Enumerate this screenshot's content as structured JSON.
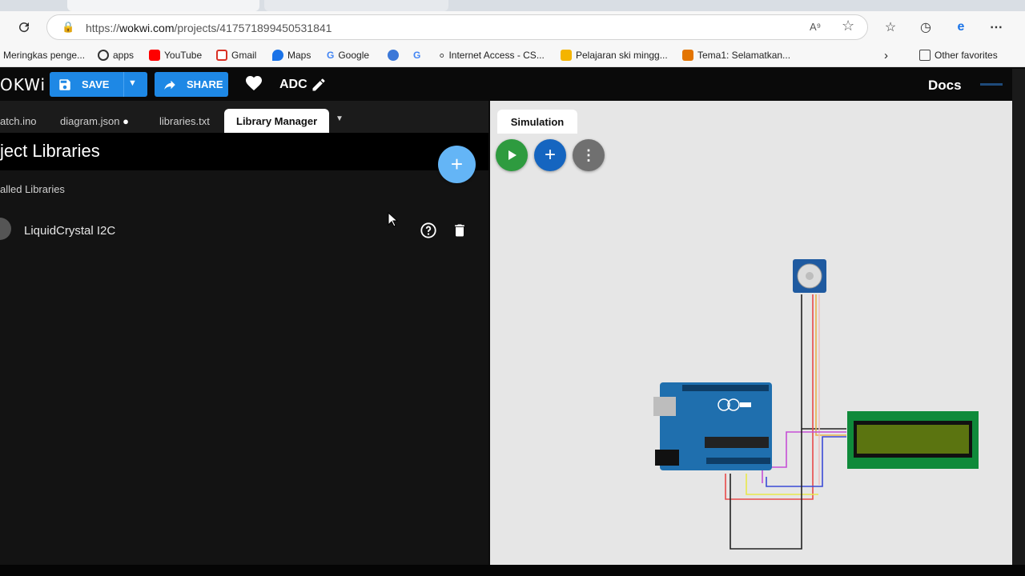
{
  "browser": {
    "url_prefix": "https://",
    "url_domain": "wokwi.com",
    "url_path": "/projects/417571899450531841",
    "bookmarks": [
      {
        "label": "Meringkas penge...",
        "color": "#1e8e3e"
      },
      {
        "label": "apps",
        "color": "#333333"
      },
      {
        "label": "YouTube",
        "color": "#ff0000"
      },
      {
        "label": "Gmail",
        "color": "#d93025"
      },
      {
        "label": "Maps",
        "color": "#1a73e8"
      },
      {
        "label": "Google",
        "color": "#4285f4"
      },
      {
        "label": "",
        "color": "#3c78d8"
      },
      {
        "label": "",
        "color": "#4285f4"
      },
      {
        "label": "Internet Access - CS...",
        "color": "#555555"
      },
      {
        "label": "Pelajaran ski mingg...",
        "color": "#f4b400"
      },
      {
        "label": "Tema1: Selamatkan...",
        "color": "#e37400"
      }
    ],
    "other_favorites": "Other favorites"
  },
  "wokwi": {
    "logo": "OKWi",
    "save_label": "SAVE",
    "share_label": "SHARE",
    "project_name": "ADC",
    "docs_label": "Docs",
    "accent": "#1e88e5"
  },
  "editor": {
    "tabs": [
      {
        "label": "atch.ino"
      },
      {
        "label": "diagram.json"
      },
      {
        "label": "libraries.txt"
      },
      {
        "label": "Library Manager"
      }
    ],
    "lib_title": "ject Libraries",
    "installed_heading": "alled Libraries",
    "libraries": [
      {
        "name": "LiquidCrystal I2C"
      }
    ]
  },
  "simulation": {
    "tab_label": "Simulation",
    "colors": {
      "play": "#2e9b3f",
      "add": "#1565c0",
      "menu": "#707070",
      "lcd_pcb": "#0f8a3a",
      "lcd_screen": "#5b7410",
      "arduino": "#1f6fae"
    }
  }
}
